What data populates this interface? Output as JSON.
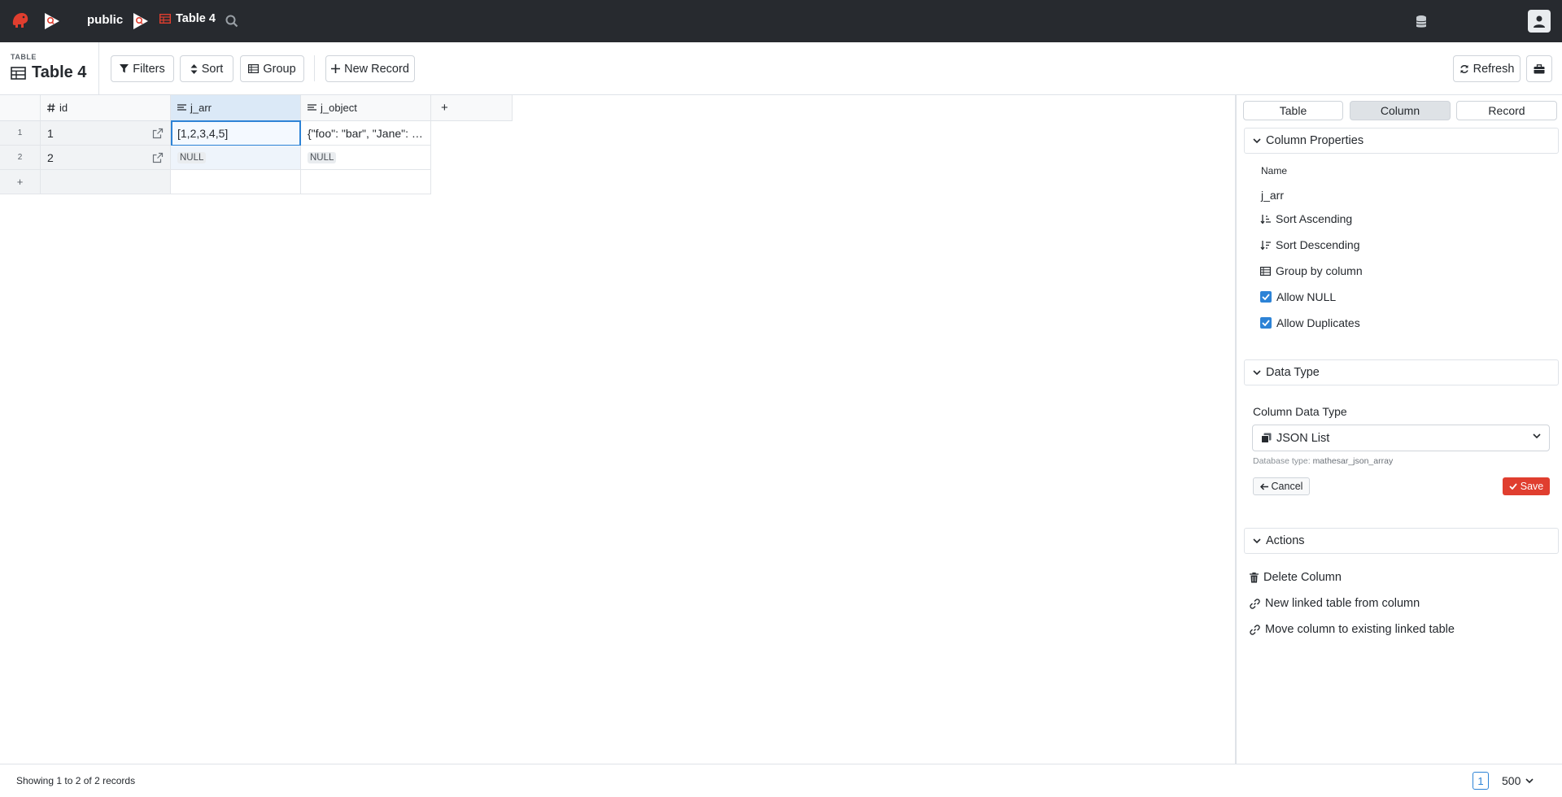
{
  "topbar": {
    "schema": "public",
    "table": "Table 4"
  },
  "header": {
    "kicker": "TABLE",
    "title": "Table 4",
    "filters_label": "Filters",
    "sort_label": "Sort",
    "group_label": "Group",
    "new_record_label": "New Record",
    "refresh_label": "Refresh"
  },
  "grid": {
    "columns": [
      {
        "name": "id",
        "icon": "hash-icon"
      },
      {
        "name": "j_arr",
        "icon": "text-lines-icon"
      },
      {
        "name": "j_object",
        "icon": "text-lines-icon"
      }
    ],
    "add_column": "+",
    "add_row": "+",
    "rows": [
      {
        "num": "1",
        "id": "1",
        "j_arr": "[1,2,3,4,5]",
        "j_object": "{\"foo\": \"bar\", \"Jane\": …"
      },
      {
        "num": "2",
        "id": "2",
        "j_arr": "NULL",
        "j_object": "NULL"
      }
    ]
  },
  "panel": {
    "tabs": [
      "Table",
      "Column",
      "Record"
    ],
    "active_tab": "Column",
    "column_properties": {
      "title": "Column Properties",
      "name_label": "Name",
      "name_value": "j_arr",
      "sort_asc": "Sort Ascending",
      "sort_desc": "Sort Descending",
      "group_by": "Group by column",
      "allow_null": "Allow NULL",
      "allow_duplicates": "Allow Duplicates"
    },
    "data_type": {
      "title": "Data Type",
      "label": "Column Data Type",
      "value": "JSON List",
      "db_type_prefix": "Database type:",
      "db_type_value": "mathesar_json_array",
      "cancel": "Cancel",
      "save": "Save"
    },
    "actions": {
      "title": "Actions",
      "delete": "Delete Column",
      "new_linked": "New linked table from column",
      "move_linked": "Move column to existing linked table"
    }
  },
  "footer": {
    "status": "Showing 1 to 2 of 2 records",
    "page": "1",
    "page_size": "500"
  },
  "colors": {
    "topbar_bg": "#272a2f",
    "brand": "#e03e2f",
    "accent": "#2d83d6"
  }
}
